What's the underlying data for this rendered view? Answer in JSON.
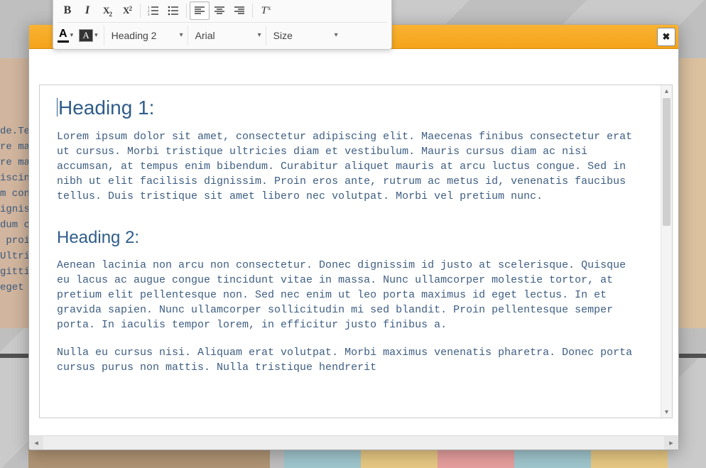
{
  "background_text": "de.Tes\nre ma\nre ma\niscing\nm con\nigniss\ndum c\n proin\nUltric\ngittis\neget n",
  "toolbar": {
    "row1": {
      "bold": "B",
      "italic": "I",
      "sub_base": "X",
      "sub_idx": "2",
      "sup_base": "X",
      "sup_idx": "2",
      "clear_base": "I",
      "clear_x": "x"
    },
    "row2": {
      "textcolor_glyph": "A",
      "bgcolor_glyph": "A",
      "heading_label": "Heading 2",
      "font_label": "Arial",
      "size_label": "Size"
    }
  },
  "close_glyph": "✖",
  "content": {
    "h1": "Heading 1:",
    "p1": "Lorem ipsum dolor sit amet, consectetur adipiscing elit. Maecenas finibus consectetur erat ut cursus. Morbi tristique ultricies diam et vestibulum. Mauris cursus diam ac nisi accumsan, at tempus enim bibendum. Curabitur aliquet mauris at arcu luctus congue. Sed in nibh ut elit facilisis dignissim. Proin eros ante, rutrum ac metus id, venenatis faucibus tellus. Duis tristique sit amet libero nec volutpat. Morbi vel pretium nunc.",
    "h2": "Heading 2:",
    "p2": "Aenean lacinia non arcu non consectetur. Donec dignissim id justo at scelerisque. Quisque eu lacus ac augue congue tincidunt vitae in massa. Nunc ullamcorper molestie tortor, at pretium elit pellentesque non. Sed nec enim ut leo porta maximus id eget lectus. In et gravida sapien. Nunc ullamcorper sollicitudin mi sed blandit. Proin pellentesque semper porta. In iaculis tempor lorem, in efficitur justo finibus a.",
    "p3": "Nulla eu cursus nisi. Aliquam erat volutpat. Morbi maximus venenatis pharetra. Donec porta cursus purus non mattis. Nulla tristique hendrerit"
  }
}
